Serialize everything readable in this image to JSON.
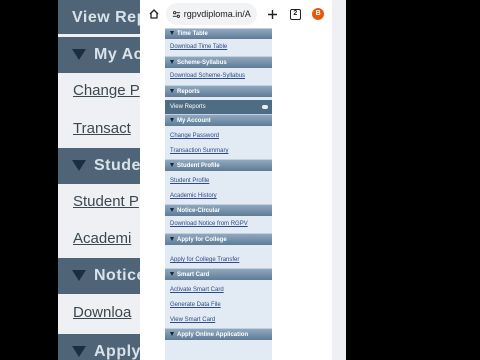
{
  "background_left": {
    "rows": [
      {
        "kind": "head",
        "text": "View Repo",
        "tri": false
      },
      {
        "kind": "head",
        "text": "My Ac",
        "tri": true
      },
      {
        "kind": "link",
        "text": "Change P"
      },
      {
        "kind": "link",
        "text": "Transact"
      },
      {
        "kind": "head",
        "text": "Student",
        "tri": true
      },
      {
        "kind": "link",
        "text": "Student P"
      },
      {
        "kind": "link",
        "text": "Academi"
      },
      {
        "kind": "head",
        "text": "Notice",
        "tri": true
      },
      {
        "kind": "link",
        "text": "Downloa"
      },
      {
        "kind": "head",
        "text": "Apply",
        "tri": true
      }
    ]
  },
  "browser": {
    "url": "rgpvdiploma.in/A",
    "tab_count": "2",
    "profile_initial": "B",
    "icons": [
      "home-icon",
      "site-info-icon",
      "new-tab-plus-icon",
      "tabs-icon",
      "avatar"
    ]
  },
  "menu": {
    "time_table": {
      "title": "Time Table",
      "link": "Download Time Table"
    },
    "scheme_syllabus": {
      "title": "Scheme-Syllabus",
      "link": "Download Scheme-Syllabus"
    },
    "reports": {
      "title": "Reports",
      "active_item": "View Reports"
    },
    "my_account": {
      "title": "My Account",
      "links": [
        "Change Password",
        "Transaction Summary"
      ]
    },
    "student_profile": {
      "title": "Student Profile",
      "links": [
        "Student Profile",
        "Academic History"
      ]
    },
    "notice_circular": {
      "title": "Notice-Circular",
      "link": "Download Notice from RGPV"
    },
    "apply_college": {
      "title": "Apply for College",
      "link": "Apply for College Transfer"
    },
    "smart_card": {
      "title": "Smart Card",
      "links": [
        "Activate Smart Card",
        "Generate Data File",
        "View Smart Card"
      ]
    },
    "apply_online": {
      "title": "Apply Online Application"
    }
  },
  "colors": {
    "header_top": "#8fa8bf",
    "header_bottom": "#5f7b95",
    "menu_background": "#e2eaf3",
    "link": "#2c4a86",
    "active_item": "#4f6c85",
    "avatar": "#e8580c"
  }
}
